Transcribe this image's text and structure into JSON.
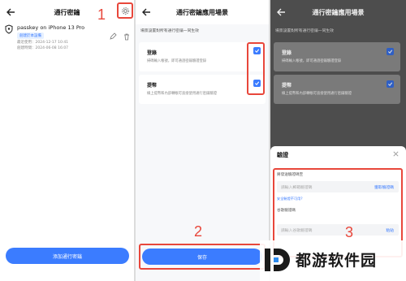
{
  "colors": {
    "accent": "#3b7cff",
    "annotation": "#e8473b"
  },
  "screen1": {
    "title": "通行密鑰",
    "passkey": {
      "name": "passkey on iPhone 13 Pro",
      "badge": "創建於本設備",
      "last_used": "最近使用：2024-12-17 10:41",
      "created": "創建時間：2024-06-08 16:07"
    },
    "add_button": "添加通行密鑰",
    "step": "1"
  },
  "screen2": {
    "title": "通行密鑰應用場景",
    "description": "場景設置對所有通行密鑰一同生效",
    "options": [
      {
        "title": "登錄",
        "desc": "掃碼輸入帳號，即可通過密鑰驗證登錄",
        "checked": true
      },
      {
        "title": "提幣",
        "desc": "線上提幣和內部轉帳可直接使用通行密鑰驗證",
        "checked": true
      }
    ],
    "save_button": "保存",
    "step": "2"
  },
  "screen3": {
    "title": "通行密鑰應用場景",
    "description": "場景設置對所有通行密鑰一同生效",
    "options": [
      {
        "title": "登錄",
        "desc": "掃碼輸入帳號，即可通過密鑰驗證登錄"
      },
      {
        "title": "提幣",
        "desc": "線上提幣和內部轉帳可直接使用通行密鑰驗證"
      }
    ],
    "sheet": {
      "title": "驗證",
      "email_label": "將發送驗證碼至",
      "email_placeholder": "請輸入郵箱驗證碼",
      "get_code": "獲取驗證碼",
      "unavailable_link": "安全驗證不可用?",
      "google_label": "谷歌驗證碼",
      "google_placeholder": "請輸入谷歌驗證碼",
      "paste": "粘貼"
    },
    "step": "3"
  },
  "watermark": {
    "text": "都游软件园",
    "logo": "d-logo"
  }
}
